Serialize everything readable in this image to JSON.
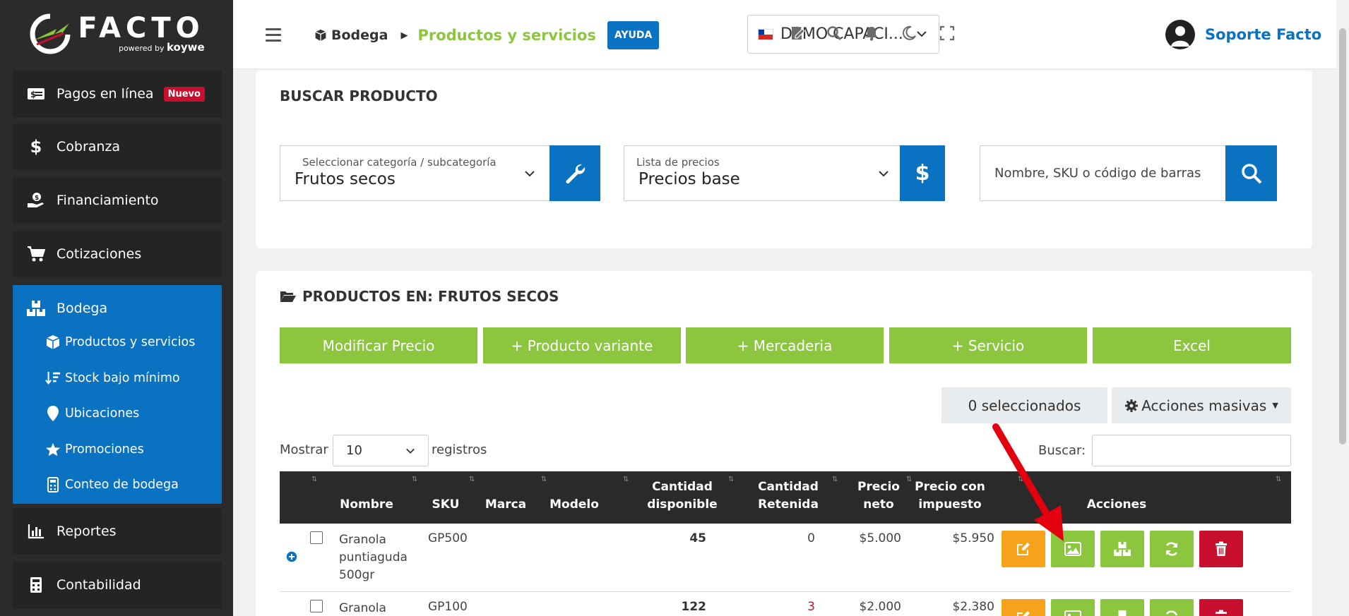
{
  "sidebar": {
    "logo": {
      "text": "FACTO",
      "powered": "powered",
      "by": "by",
      "brand": "koywe"
    },
    "items": [
      {
        "label": "Pagos en línea",
        "badge": "Nuevo",
        "icon": "money-bill-icon"
      },
      {
        "label": "Cobranza",
        "icon": "dollar-icon"
      },
      {
        "label": "Financiamiento",
        "icon": "hand-holding-dollar-icon"
      },
      {
        "label": "Cotizaciones",
        "icon": "cart-icon"
      },
      {
        "label": "Bodega",
        "icon": "boxes-icon"
      },
      {
        "label": "Reportes",
        "icon": "chart-bar-icon"
      },
      {
        "label": "Contabilidad",
        "icon": "calculator-icon"
      }
    ],
    "bodega_sub": [
      {
        "label": "Productos y servicios",
        "icon": "cube-icon"
      },
      {
        "label": "Stock bajo mínimo",
        "icon": "sort-amount-down-icon"
      },
      {
        "label": "Ubicaciones",
        "icon": "map-marker-icon"
      },
      {
        "label": "Promociones",
        "icon": "star-icon"
      },
      {
        "label": "Conteo de bodega",
        "icon": "calculator-icon"
      }
    ]
  },
  "header": {
    "breadcrumb_root": "Bodega",
    "breadcrumb_current": "Productos y servicios",
    "help": "AYUDA",
    "company": "DEMO CAPACI...",
    "user": "Soporte Facto"
  },
  "search": {
    "title": "BUSCAR PRODUCTO",
    "category_label": "Seleccionar categoría / subcategoría",
    "category_value": "Frutos secos",
    "pricelist_label": "Lista de precios",
    "pricelist_value": "Precios base",
    "query_placeholder": "Nombre, SKU o código de barras"
  },
  "products": {
    "title": "PRODUCTOS EN: FRUTOS SECOS",
    "buttons": [
      "Modificar Precio",
      "+ Producto variante",
      "+ Mercaderia",
      "+ Servicio",
      "Excel"
    ],
    "selected": "0 seleccionados",
    "bulk": "Acciones masivas",
    "show_label": "Mostrar",
    "show_value": "10",
    "records_label": "registros",
    "search_label": "Buscar:",
    "columns": [
      {
        "l1": "",
        "l2": "Nombre"
      },
      {
        "l1": "",
        "l2": "SKU"
      },
      {
        "l1": "",
        "l2": "Marca"
      },
      {
        "l1": "",
        "l2": "Modelo"
      },
      {
        "l1": "Cantidad",
        "l2": "disponible"
      },
      {
        "l1": "Cantidad",
        "l2": "Retenida"
      },
      {
        "l1": "Precio",
        "l2": "neto"
      },
      {
        "l1": "Precio con",
        "l2": "impuesto"
      },
      {
        "l1": "",
        "l2": "Acciones"
      }
    ],
    "rows": [
      {
        "name": [
          "Granola",
          "puntiaguda",
          "500gr"
        ],
        "sku": "GP500",
        "available": "45",
        "retained": "0",
        "net": "$5.000",
        "gross": "$5.950"
      },
      {
        "name": [
          "Granola"
        ],
        "sku": "GP100",
        "available": "122",
        "retained": "3",
        "net": "$2.000",
        "gross": "$2.380"
      }
    ]
  },
  "colors": {
    "brand_blue": "#0a72c0",
    "green": "#8cc63f",
    "orange": "#f7a21b",
    "red": "#c8102e",
    "sidebar_bg": "#2b2b2b",
    "annotation_arrow": "#e3000f"
  }
}
